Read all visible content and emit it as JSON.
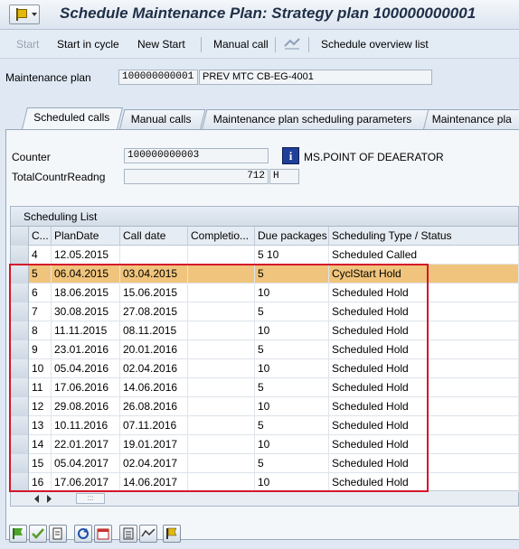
{
  "window": {
    "title": "Schedule Maintenance Plan: Strategy plan 100000000001"
  },
  "toolbar": {
    "start": "Start",
    "start_in_cycle": "Start in cycle",
    "new_start": "New Start",
    "manual_call": "Manual call",
    "schedule_overview": "Schedule overview list"
  },
  "header": {
    "maintenance_plan_label": "Maintenance plan",
    "maintenance_plan_value": "100000000001",
    "maintenance_plan_text": "PREV MTC CB-EG-4001"
  },
  "tabs": [
    {
      "label": "Scheduled calls",
      "active": true
    },
    {
      "label": "Manual calls",
      "active": false
    },
    {
      "label": "Maintenance plan scheduling parameters",
      "active": false
    },
    {
      "label": "Maintenance pla",
      "active": false
    }
  ],
  "counter": {
    "counter_label": "Counter",
    "counter_value": "100000000003",
    "counter_desc": "MS.POINT OF DEAERATOR",
    "total_label": "TotalCountrReadng",
    "total_value": "712",
    "unit": "H"
  },
  "list": {
    "title": "Scheduling List",
    "columns": [
      "C...",
      "PlanDate",
      "Call date",
      "Completio...",
      "Due packages",
      "Scheduling Type / Status"
    ],
    "rows": [
      {
        "c": "4",
        "plan": "12.05.2015",
        "call": "",
        "comp": "",
        "due": "5  10",
        "sched": "Scheduled  Called"
      },
      {
        "c": "5",
        "plan": "06.04.2015",
        "call": "03.04.2015",
        "comp": "",
        "due": "5",
        "sched": "CyclStart  Hold"
      },
      {
        "c": "6",
        "plan": "18.06.2015",
        "call": "15.06.2015",
        "comp": "",
        "due": "10",
        "sched": "Scheduled  Hold"
      },
      {
        "c": "7",
        "plan": "30.08.2015",
        "call": "27.08.2015",
        "comp": "",
        "due": "5",
        "sched": "Scheduled  Hold"
      },
      {
        "c": "8",
        "plan": "11.11.2015",
        "call": "08.11.2015",
        "comp": "",
        "due": "10",
        "sched": "Scheduled  Hold"
      },
      {
        "c": "9",
        "plan": "23.01.2016",
        "call": "20.01.2016",
        "comp": "",
        "due": "5",
        "sched": "Scheduled  Hold"
      },
      {
        "c": "10",
        "plan": "05.04.2016",
        "call": "02.04.2016",
        "comp": "",
        "due": "10",
        "sched": "Scheduled  Hold"
      },
      {
        "c": "11",
        "plan": "17.06.2016",
        "call": "14.06.2016",
        "comp": "",
        "due": "5",
        "sched": "Scheduled  Hold"
      },
      {
        "c": "12",
        "plan": "29.08.2016",
        "call": "26.08.2016",
        "comp": "",
        "due": "10",
        "sched": "Scheduled  Hold"
      },
      {
        "c": "13",
        "plan": "10.11.2016",
        "call": "07.11.2016",
        "comp": "",
        "due": "5",
        "sched": "Scheduled  Hold"
      },
      {
        "c": "14",
        "plan": "22.01.2017",
        "call": "19.01.2017",
        "comp": "",
        "due": "10",
        "sched": "Scheduled  Hold"
      },
      {
        "c": "15",
        "plan": "05.04.2017",
        "call": "02.04.2017",
        "comp": "",
        "due": "5",
        "sched": "Scheduled  Hold"
      },
      {
        "c": "16",
        "plan": "17.06.2017",
        "call": "14.06.2017",
        "comp": "",
        "due": "10",
        "sched": "Scheduled  Hold"
      }
    ],
    "highlight_color": "#f0c47c"
  },
  "bottom_toolbar": {
    "icons": [
      "release-call-icon",
      "fix-call-icon",
      "skip-call-icon",
      "refresh-icon",
      "calendar-icon",
      "calculator-icon",
      "graphic-icon",
      "flag-icon"
    ]
  }
}
